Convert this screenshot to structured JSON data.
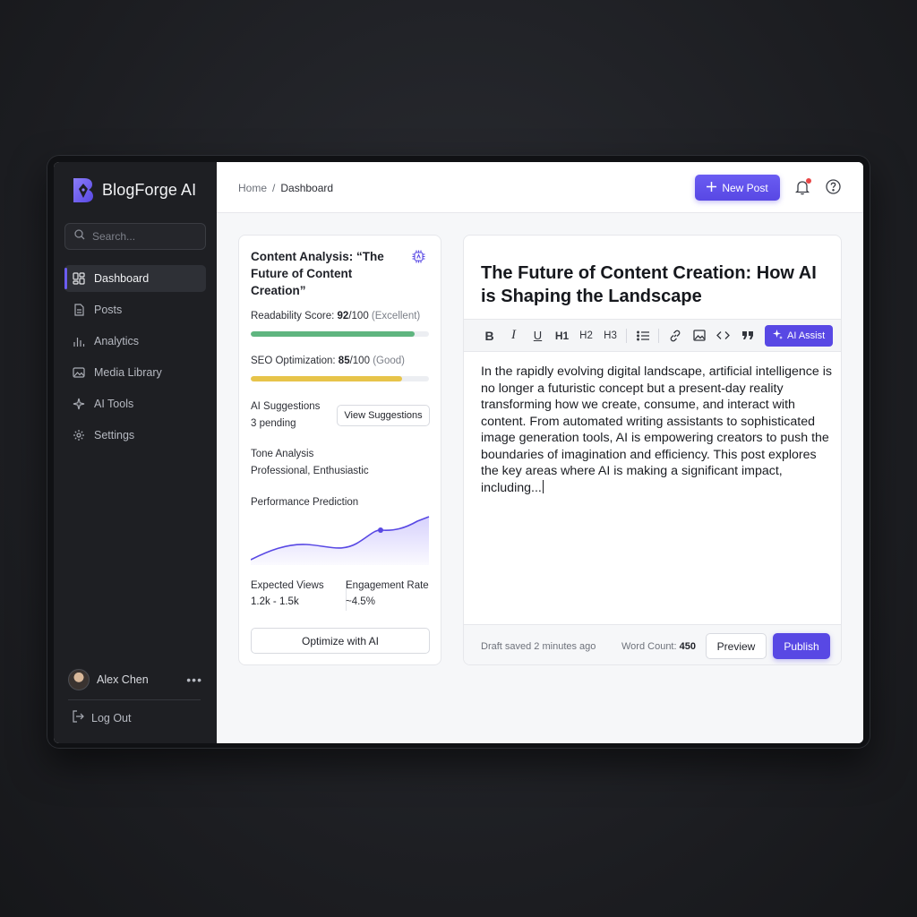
{
  "app": {
    "name": "BlogForge AI",
    "accent": "#5848e4"
  },
  "sidebar": {
    "search_placeholder": "Search...",
    "items": [
      {
        "label": "Dashboard",
        "icon": "dashboard-icon",
        "active": true
      },
      {
        "label": "Posts",
        "icon": "document-icon"
      },
      {
        "label": "Analytics",
        "icon": "bar-chart-icon"
      },
      {
        "label": "Media Library",
        "icon": "image-icon"
      },
      {
        "label": "AI Tools",
        "icon": "sparkle-icon"
      },
      {
        "label": "Settings",
        "icon": "gear-icon"
      }
    ],
    "user": {
      "name": "Alex Chen",
      "more": "•••"
    },
    "logout_label": "Log Out"
  },
  "header": {
    "breadcrumb": {
      "home": "Home",
      "separator": "/",
      "current": "Dashboard"
    },
    "new_post_label": "New Post",
    "notification_indicator_color": "#e84646"
  },
  "analysis": {
    "title": "Content Analysis: “The Future of Content Creation”",
    "readability": {
      "label": "Readability Score:",
      "value": "92",
      "suffix": "/100",
      "rating": "(Excellent)",
      "fill_pct": 92,
      "color": "#5fb57f"
    },
    "seo": {
      "label": "SEO Optimization:",
      "value": "85",
      "suffix": "/100",
      "rating": "(Good)",
      "fill_pct": 85,
      "color": "#e7c44a"
    },
    "suggestions": {
      "label": "AI Suggestions",
      "count": "3 pending",
      "button": "View Suggestions"
    },
    "tone": {
      "label": "Tone Analysis",
      "value": "Professional, Enthusiastic"
    },
    "performance": {
      "label": "Performance Prediction"
    },
    "expected_views": {
      "label": "Expected Views",
      "value": "1.2k - 1.5k"
    },
    "engagement_rate": {
      "label": "Engagement Rate",
      "value": "~4.5%"
    },
    "optimize_button": "Optimize with AI"
  },
  "editor": {
    "title": "The Future of Content Creation: How AI is Shaping the Landscape",
    "toolbar": {
      "bold": "B",
      "italic": "I",
      "underline": "U",
      "h1": "H1",
      "h2": "H2",
      "h3": "H3",
      "ai_assist": "AI Assist"
    },
    "body": "In the rapidly evolving digital landscape, artificial intelligence is no longer a futuristic concept but a present-day reality transforming how we create, consume, and interact with content. From automated writing assistants to sophisticated image generation tools, AI is empowering creators to push the boundaries of imagination and efficiency. This post explores the key areas where AI is making a significant impact, including...",
    "draft_status": "Draft saved 2 minutes ago",
    "word_count_label": "Word Count:",
    "word_count": "450",
    "preview_label": "Preview",
    "publish_label": "Publish"
  }
}
